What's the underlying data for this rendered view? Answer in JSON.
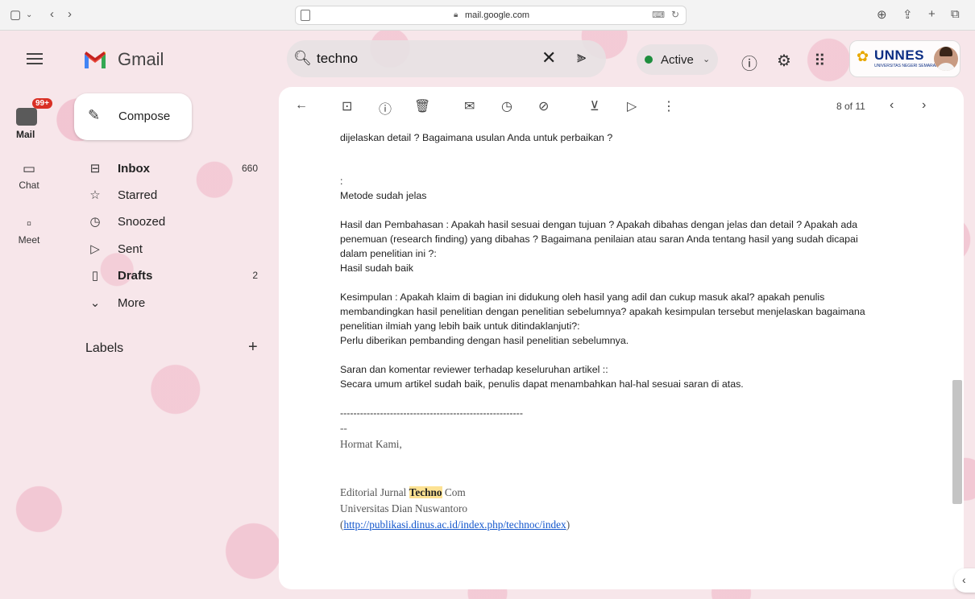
{
  "browser": {
    "url": "mail.google.com",
    "icons": [
      "sidebar-icon",
      "chevron-down-icon",
      "back-icon",
      "forward-icon",
      "page-icon",
      "lock-icon",
      "translate-icon",
      "reload-icon",
      "download-icon",
      "share-icon",
      "new-tab-icon",
      "tabs-icon"
    ]
  },
  "header": {
    "app_name": "Gmail",
    "search_query": "techno",
    "status": "Active",
    "account_org": "UNNES",
    "account_sub": "UNIVERSITAS NEGERI SEMARANG"
  },
  "rail": {
    "mail_label": "Mail",
    "mail_badge": "99+",
    "chat_label": "Chat",
    "meet_label": "Meet"
  },
  "nav": {
    "compose": "Compose",
    "items": [
      {
        "label": "Inbox",
        "count": "660",
        "bold": true,
        "icon": "inbox-icon"
      },
      {
        "label": "Starred",
        "count": "",
        "bold": false,
        "icon": "star-icon"
      },
      {
        "label": "Snoozed",
        "count": "",
        "bold": false,
        "icon": "clock-icon"
      },
      {
        "label": "Sent",
        "count": "",
        "bold": false,
        "icon": "send-icon"
      },
      {
        "label": "Drafts",
        "count": "2",
        "bold": true,
        "icon": "draft-icon"
      },
      {
        "label": "More",
        "count": "",
        "bold": false,
        "icon": "chevron-down-icon"
      }
    ],
    "labels_heading": "Labels"
  },
  "toolbar": {
    "pager_text": "8 of 11"
  },
  "message": {
    "lines": [
      "dijelaskan detail ? Bagaimana usulan Anda untuk perbaikan ?",
      ":",
      "Metode sudah jelas",
      "Hasil dan Pembahasan : Apakah hasil sesuai dengan tujuan ? Apakah dibahas dengan jelas dan detail ? Apakah ada",
      "penemuan (research finding) yang dibahas ? Bagaimana penilaian atau saran Anda tentang hasil yang sudah dicapai",
      "dalam penelitian ini ?:",
      "Hasil sudah baik",
      "Kesimpulan : Apakah klaim di bagian ini didukung oleh hasil yang adil dan cukup masuk akal? apakah penulis",
      "membandingkan hasil penelitian dengan penelitian sebelumnya? apakah kesimpulan tersebut menjelaskan bagaimana",
      "penelitian ilmiah yang lebih baik untuk ditindaklanjuti?:",
      "Perlu diberikan pembanding dengan hasil penelitian sebelumnya.",
      "Saran dan komentar reviewer terhadap keseluruhan artikel ::",
      "Secara umum artikel sudah baik, penulis dapat menambahkan hal-hal sesuai saran di atas.",
      "-------------------------------------------------------"
    ],
    "sig_dash": "--",
    "sig_regards": "Hormat Kami,",
    "sig_journal_pre": "Editorial Jurnal ",
    "sig_journal_hl": "Techno",
    "sig_journal_post": " Com",
    "sig_university": "Universitas Dian Nuswantoro",
    "sig_link_open": "(",
    "sig_link": "http://publikasi.dinus.ac.id/index.php/technoc/index",
    "sig_link_close": ")"
  },
  "colors": {
    "badge": "#d93025",
    "active_dot": "#1e8e3e",
    "highlight": "#fde293",
    "link": "#1155cc",
    "theme_bg": "#f7e6ea"
  }
}
